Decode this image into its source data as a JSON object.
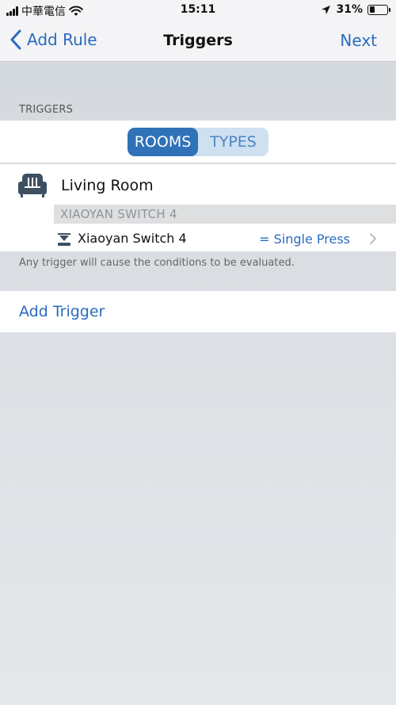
{
  "status_bar": {
    "carrier": "中華電信",
    "time": "15:11",
    "battery_percent": "31%",
    "battery_level": 0.31,
    "icons": [
      "signal-icon",
      "wifi-icon",
      "location-arrow-icon",
      "battery-icon"
    ]
  },
  "nav": {
    "back_label": "Add Rule",
    "title": "Triggers",
    "next_label": "Next"
  },
  "triggers_section": {
    "header": "TRIGGERS",
    "segments": [
      {
        "label": "ROOMS",
        "selected": true
      },
      {
        "label": "TYPES",
        "selected": false
      }
    ],
    "room": {
      "name": "Living Room",
      "icon": "sofa-icon",
      "device_header": "XIAOYAN SWITCH 4",
      "trigger": {
        "device_name": "Xiaoyan Switch 4",
        "value": "= Single Press",
        "icon": "switch-icon"
      }
    },
    "footnote": "Any trigger will cause the conditions to be evaluated."
  },
  "add_trigger": {
    "label": "Add Trigger"
  },
  "colors": {
    "accent": "#2a6bbf",
    "segment_active": "#2f72b8",
    "segment_bg": "#cfe0f1",
    "background": "#dde1e5"
  }
}
